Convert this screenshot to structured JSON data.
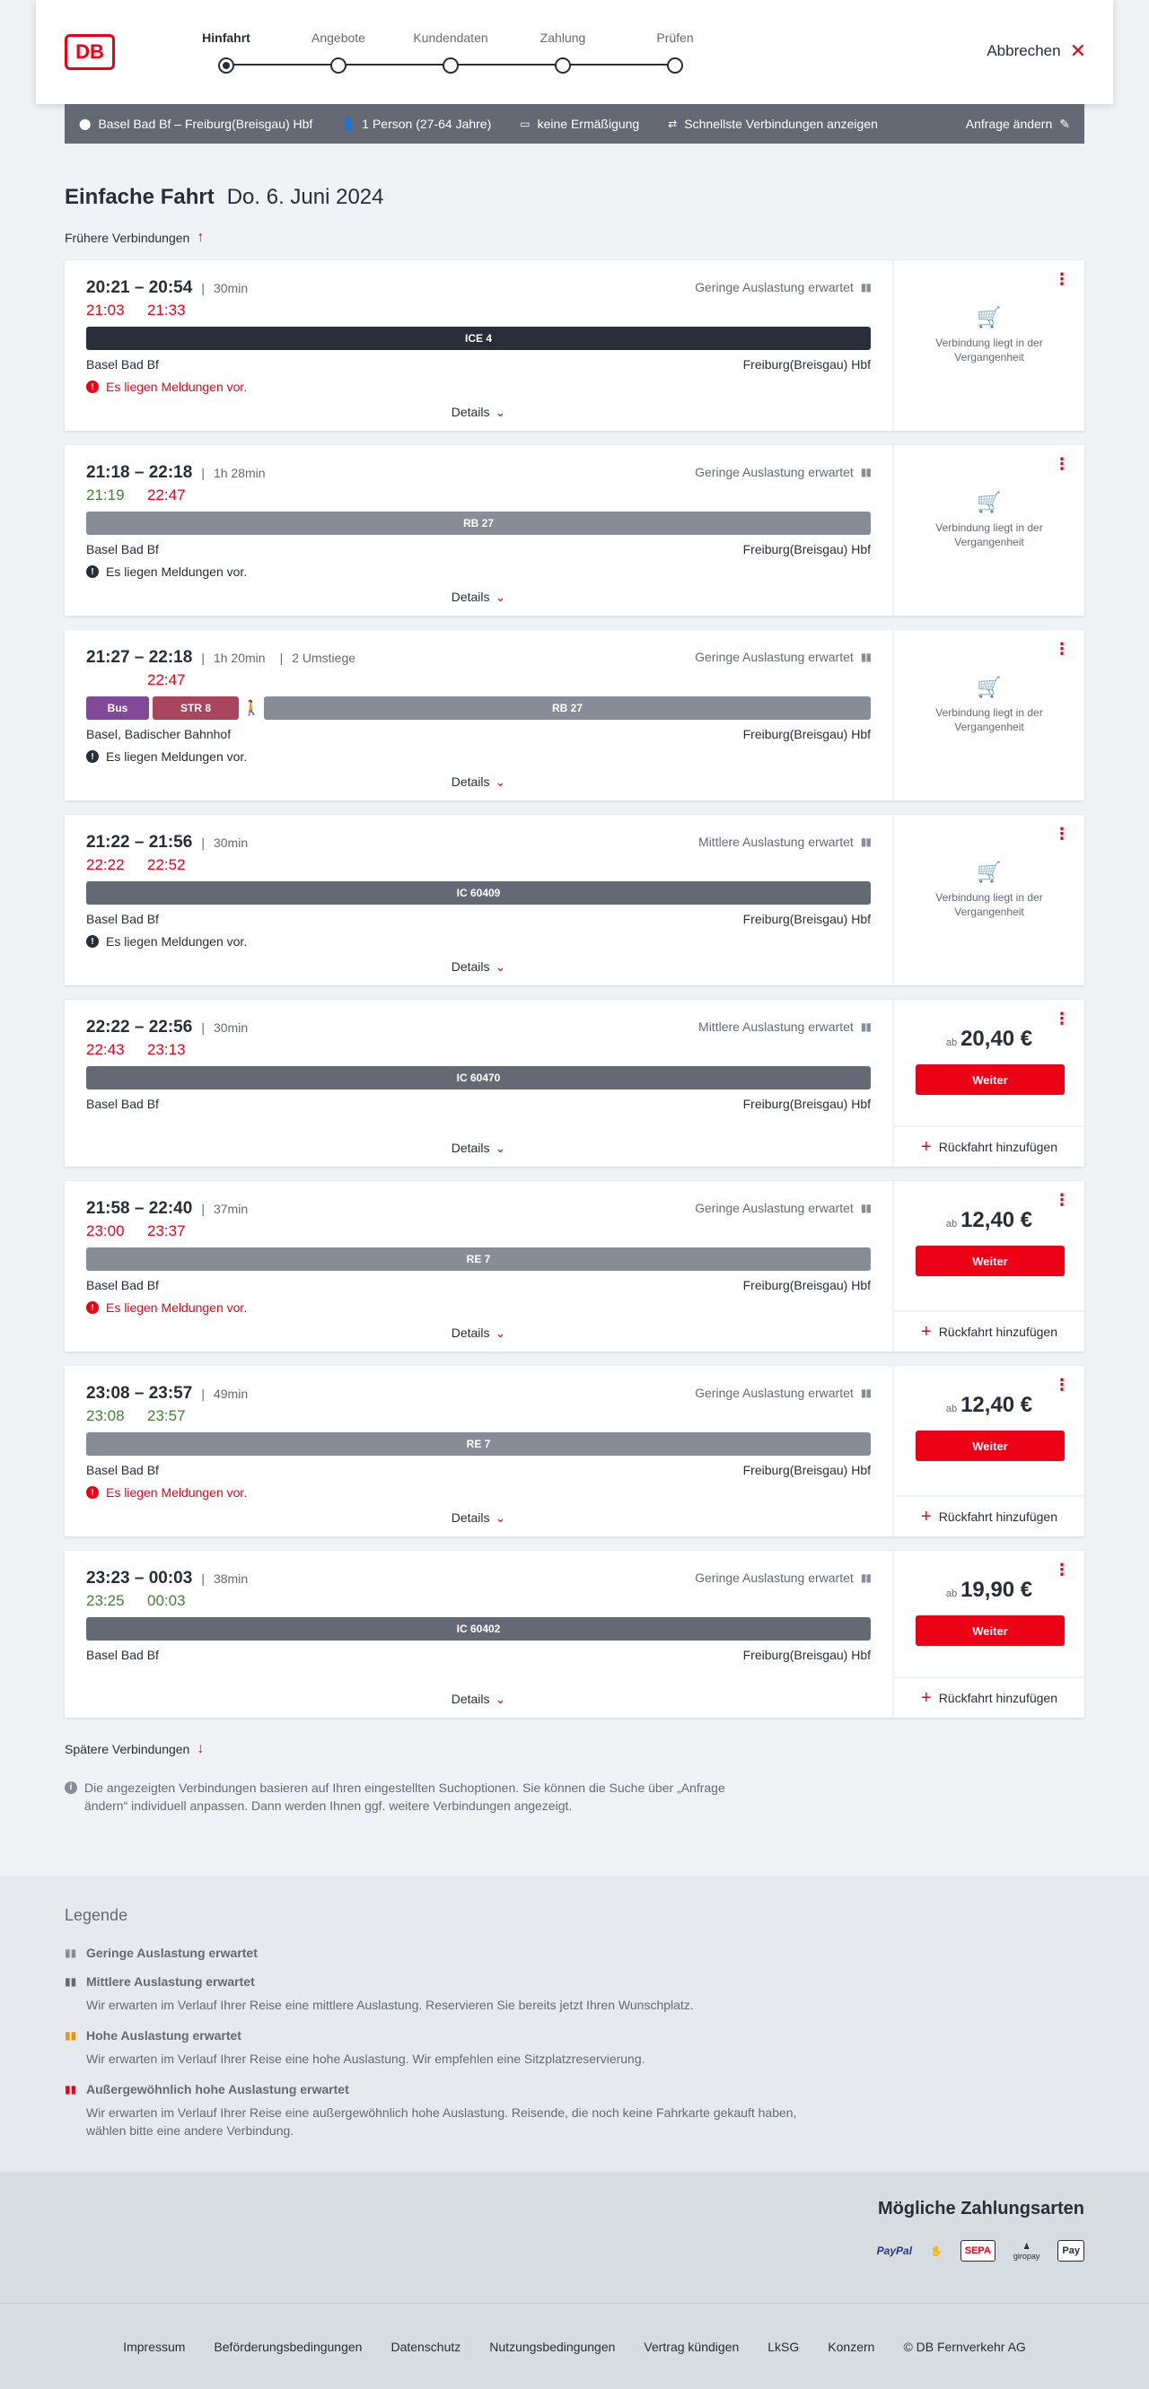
{
  "header": {
    "logo": "DB",
    "steps": [
      "Hinfahrt",
      "Angebote",
      "Kundendaten",
      "Zahlung",
      "Prüfen"
    ],
    "active_step": 0,
    "cancel_label": "Abbrechen"
  },
  "summary": {
    "route": "Basel Bad Bf – Freiburg(Breisgau) Hbf",
    "travellers": "1 Person (27-64 Jahre)",
    "discount": "keine Ermäßigung",
    "fastest": "Schnellste Verbindungen anzeigen",
    "change": "Anfrage ändern"
  },
  "page": {
    "title": "Einfache Fahrt",
    "date": "Do. 6. Juni 2024",
    "earlier": "Frühere Verbindungen",
    "later": "Spätere Verbindungen",
    "details_label": "Details",
    "past_text": "Verbindung liegt in der Vergangenheit",
    "price_prefix": "ab",
    "weiter_label": "Weiter",
    "return_label": "Rückfahrt hinzufügen",
    "note": "Die angezeigten Verbindungen basieren auf Ihren eingestellten Suchoptionen. Sie können die Suche über „Anfrage ändern“ individuell anpassen. Dann werden Ihnen ggf. weitere Verbindungen angezeigt."
  },
  "connections": [
    {
      "time": "20:21 – 20:54",
      "duration": "30min",
      "transfers": "",
      "rt_dep": "21:03",
      "rt_dep_color": "red",
      "rt_arr": "21:33",
      "rt_arr_color": "red",
      "occupancy": "Geringe Auslastung erwartet",
      "segments": [
        {
          "label": "ICE 4",
          "kind": "ice",
          "grow": 1
        }
      ],
      "walk": false,
      "from": "Basel Bad Bf",
      "to": "Freiburg(Breisgau) Hbf",
      "message": "Es liegen Meldungen vor.",
      "message_type": "warn",
      "status": "past",
      "price": ""
    },
    {
      "time": "21:18 – 22:18",
      "duration": "1h 28min",
      "transfers": "",
      "rt_dep": "21:19",
      "rt_dep_color": "green",
      "rt_arr": "22:47",
      "rt_arr_color": "red",
      "occupancy": "Geringe Auslastung erwartet",
      "segments": [
        {
          "label": "RB 27",
          "kind": "rb",
          "grow": 1
        }
      ],
      "walk": false,
      "from": "Basel Bad Bf",
      "to": "Freiburg(Breisgau) Hbf",
      "message": "Es liegen Meldungen vor.",
      "message_type": "info",
      "status": "past",
      "price": ""
    },
    {
      "time": "21:27 – 22:18",
      "duration": "1h 20min",
      "transfers": "2 Umstiege",
      "rt_dep": "",
      "rt_dep_color": "red",
      "rt_arr": "22:47",
      "rt_arr_color": "red",
      "occupancy": "Geringe Auslastung erwartet",
      "segments": [
        {
          "label": "Bus",
          "kind": "bus",
          "grow": 0,
          "width": 70
        },
        {
          "label": "STR 8",
          "kind": "str",
          "grow": 0,
          "width": 96
        },
        {
          "label": "RB 27",
          "kind": "rb",
          "grow": 1
        }
      ],
      "walk": true,
      "from": "Basel, Badischer Bahnhof",
      "to": "Freiburg(Breisgau) Hbf",
      "message": "Es liegen Meldungen vor.",
      "message_type": "info",
      "status": "past",
      "price": ""
    },
    {
      "time": "21:22 – 21:56",
      "duration": "30min",
      "transfers": "",
      "rt_dep": "22:22",
      "rt_dep_color": "red",
      "rt_arr": "22:52",
      "rt_arr_color": "red",
      "occupancy": "Mittlere Auslastung erwartet",
      "segments": [
        {
          "label": "IC 60409",
          "kind": "ic",
          "grow": 1
        }
      ],
      "walk": false,
      "from": "Basel Bad Bf",
      "to": "Freiburg(Breisgau) Hbf",
      "message": "Es liegen Meldungen vor.",
      "message_type": "info",
      "status": "past",
      "price": ""
    },
    {
      "time": "22:22 – 22:56",
      "duration": "30min",
      "transfers": "",
      "rt_dep": "22:43",
      "rt_dep_color": "red",
      "rt_arr": "23:13",
      "rt_arr_color": "red",
      "occupancy": "Mittlere Auslastung erwartet",
      "segments": [
        {
          "label": "IC 60470",
          "kind": "ic",
          "grow": 1
        }
      ],
      "walk": false,
      "from": "Basel Bad Bf",
      "to": "Freiburg(Breisgau) Hbf",
      "message": "",
      "message_type": "",
      "status": "bookable",
      "price": "20,40 €"
    },
    {
      "time": "21:58 – 22:40",
      "duration": "37min",
      "transfers": "",
      "rt_dep": "23:00",
      "rt_dep_color": "red",
      "rt_arr": "23:37",
      "rt_arr_color": "red",
      "occupancy": "Geringe Auslastung erwartet",
      "segments": [
        {
          "label": "RE 7",
          "kind": "rb",
          "grow": 1
        }
      ],
      "walk": false,
      "from": "Basel Bad Bf",
      "to": "Freiburg(Breisgau) Hbf",
      "message": "Es liegen Meldungen vor.",
      "message_type": "warn",
      "status": "bookable",
      "price": "12,40 €"
    },
    {
      "time": "23:08 – 23:57",
      "duration": "49min",
      "transfers": "",
      "rt_dep": "23:08",
      "rt_dep_color": "green",
      "rt_arr": "23:57",
      "rt_arr_color": "green",
      "occupancy": "Geringe Auslastung erwartet",
      "segments": [
        {
          "label": "RE 7",
          "kind": "rb",
          "grow": 1
        }
      ],
      "walk": false,
      "from": "Basel Bad Bf",
      "to": "Freiburg(Breisgau) Hbf",
      "message": "Es liegen Meldungen vor.",
      "message_type": "warn",
      "status": "bookable",
      "price": "12,40 €"
    },
    {
      "time": "23:23 – 00:03",
      "duration": "38min",
      "transfers": "",
      "rt_dep": "23:25",
      "rt_dep_color": "green",
      "rt_arr": "00:03",
      "rt_arr_color": "green",
      "occupancy": "Geringe Auslastung erwartet",
      "segments": [
        {
          "label": "IC 60402",
          "kind": "ic",
          "grow": 1
        }
      ],
      "walk": false,
      "from": "Basel Bad Bf",
      "to": "Freiburg(Breisgau) Hbf",
      "message": "",
      "message_type": "",
      "status": "bookable",
      "price": "19,90 €"
    }
  ],
  "legend": {
    "title": "Legende",
    "items": [
      {
        "icon_color": "#878c96",
        "title": "Geringe Auslastung erwartet",
        "desc": ""
      },
      {
        "icon_color": "#646973",
        "title": "Mittlere Auslastung erwartet",
        "desc": "Wir erwarten im Verlauf Ihrer Reise eine mittlere Auslastung. Reservieren Sie bereits jetzt Ihren Wunschplatz."
      },
      {
        "icon_color": "#f39200",
        "title": "Hohe Auslastung erwartet",
        "desc": "Wir erwarten im Verlauf Ihrer Reise eine hohe Auslastung. Wir empfehlen eine Sitzplatzreservierung."
      },
      {
        "icon_color": "#ec0016",
        "title": "Außergewöhnlich hohe Auslastung erwartet",
        "desc": "Wir erwarten im Verlauf Ihrer Reise eine außergewöhnlich hohe Auslastung. Reisende, die noch keine Fahrkarte gekauft haben, wählen bitte eine andere Verbindung."
      }
    ]
  },
  "payments": {
    "title": "Mögliche Zahlungsarten",
    "methods": [
      "PayPal",
      "SEPA",
      "giropay",
      "Pay"
    ]
  },
  "footer": {
    "links": [
      "Impressum",
      "Beförderungsbedingungen",
      "Datenschutz",
      "Nutzungsbedingungen",
      "Vertrag kündigen",
      "LkSG",
      "Konzern",
      "© DB Fernverkehr AG"
    ]
  }
}
